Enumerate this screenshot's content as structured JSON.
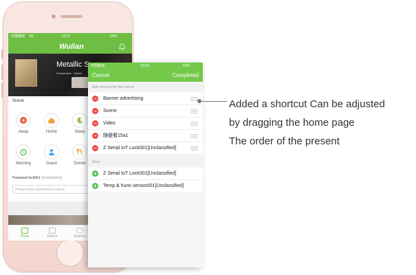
{
  "phone_back": {
    "status_bar": {
      "carrier": "中国移动",
      "network": "4G",
      "time": "10:21",
      "battery": "53%"
    },
    "app_title": "Wulian",
    "banner": {
      "title": "Metallic Su",
      "subtitle": "Fashionable · Stylish"
    },
    "scene_section_title": "Scene",
    "scenes": [
      {
        "label": "Away",
        "icon": "away-icon",
        "color": "#e9603c"
      },
      {
        "label": "Home",
        "icon": "home-icon",
        "color": "#f0a23a"
      },
      {
        "label": "Sleep",
        "icon": "moon-icon",
        "color": "#8bc34a"
      },
      {
        "label": "Morning",
        "icon": "alarm-clock-icon",
        "color": "#4caf50"
      },
      {
        "label": "Guest",
        "icon": "guest-icon",
        "color": "#42a5f5"
      },
      {
        "label": "Dinner",
        "icon": "fork-knife-icon",
        "color": "#f0a23a"
      }
    ],
    "password_lock": {
      "label": "Password lock001",
      "status": "[Unclassified]",
      "placeholder": "Please enter password to unlock"
    },
    "tabs": [
      {
        "label": "Home",
        "icon": "home-tab-icon",
        "active": true
      },
      {
        "label": "Device",
        "icon": "device-tab-icon",
        "active": false
      },
      {
        "label": "Explore",
        "icon": "explore-tab-icon",
        "active": false
      }
    ]
  },
  "edit_screen": {
    "status_bar": {
      "carrier": "中国移动",
      "time": "10:23",
      "battery": "60%"
    },
    "nav": {
      "cancel": "Cancel",
      "done": "Completed"
    },
    "shortcut_section": "Add shortcut for fast control",
    "shortcuts": [
      "Banner advertising",
      "Scene",
      "Video",
      "随便看15a1",
      "Z Serial IoT Lock001[Unclassified]"
    ],
    "more_section": "More",
    "more_items": [
      "Z Serial IoT Lock002[Unclassified]",
      "Temp & humi sensor001[Unclassified]"
    ]
  },
  "callout": {
    "lines": [
      "Added a shortcut  Can be adjusted",
      "by dragging the home page",
      "The order of the present"
    ]
  },
  "colors": {
    "brand_green": "#6fbe44",
    "remove_red": "#ef4848",
    "add_green": "#4fc25a"
  }
}
